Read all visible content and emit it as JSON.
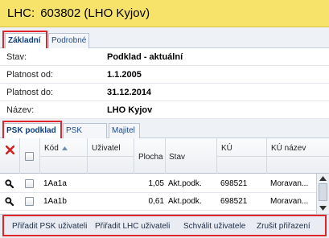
{
  "header": {
    "label": "LHC:",
    "value": "603802 (LHO Kyjov)"
  },
  "tabs_main": [
    {
      "label": "Základní",
      "active": true
    },
    {
      "label": "Podrobné",
      "active": false
    }
  ],
  "form": [
    {
      "label": "Stav:",
      "value": "Podklad - aktuální"
    },
    {
      "label": "Platnost od:",
      "value": "1.1.2005"
    },
    {
      "label": "Platnost do:",
      "value": "31.12.2014"
    },
    {
      "label": "Název:",
      "value": "LHO Kyjov"
    }
  ],
  "tabs_sub": [
    {
      "label": "PSK podklad",
      "active": true
    },
    {
      "label": "PSK zákres",
      "active": false
    },
    {
      "label": "Majitel",
      "active": false
    }
  ],
  "grid": {
    "columns": {
      "kod": "Kód",
      "uzivatel": "Uživatel",
      "plocha": "Plocha",
      "stav": "Stav",
      "ku": "KÚ",
      "ku_nazev": "KÚ název"
    },
    "sort_column": "kod",
    "rows": [
      {
        "kod": "1Aa1a",
        "uzivatel": "",
        "plocha": "1,05",
        "stav": "Akt.podk.",
        "ku": "698521",
        "ku_nazev": "Moravan..."
      },
      {
        "kod": "1Aa1b",
        "uzivatel": "",
        "plocha": "0,61",
        "stav": "Akt.podk.",
        "ku": "698521",
        "ku_nazev": "Moravan..."
      }
    ]
  },
  "footer": {
    "assign_psk": "Přiřadit PSK uživateli",
    "assign_lhc": "Přiřadit LHC uživateli",
    "approve": "Schválit uživatele",
    "cancel": "Zrušit přiřazení"
  },
  "colors": {
    "header_bg": "#f7e36a",
    "highlight": "#e0262a",
    "tab_text": "#1f4a86"
  },
  "icons": [
    "delete-icon",
    "magnifier-icon",
    "sort-ascending-icon",
    "scroll-up-icon",
    "scroll-down-icon"
  ]
}
